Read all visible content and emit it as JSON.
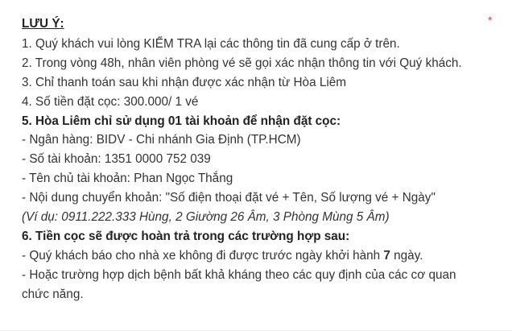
{
  "notice": {
    "heading": "LƯU Ý:",
    "required_marker": "*",
    "items": [
      "1. Quý khách vui lòng KIỂM TRA lại các thông tin đã cung cấp ở trên.",
      "2. Trong vòng 48h, nhân viên phòng vé sẽ gọi xác nhận thông tin với Quý khách.",
      "3. Chỉ thanh toán sau khi nhận được xác nhận từ Hòa Liêm",
      "4. Số tiền đặt cọc: 300.000/ 1 vé"
    ],
    "deposit_heading": "5. Hòa Liêm chỉ sử dụng 01 tài khoản để nhận đặt cọc:",
    "bank_lines": [
      "- Ngân hàng: BIDV - Chi nhánh Gia Định (TP.HCM)",
      "- Số tài khoản: 1351 0000 752 039",
      "- Tên chủ tài khoản: Phan Ngọc Thắng",
      "- Nội dung chuyển khoản: \"Số điện thoại đặt vé + Tên, Số lượng vé + Ngày\""
    ],
    "example": "(Ví dụ: 0911.222.333 Hùng, 2 Giường 26 Âm, 3 Phòng Mùng 5 Âm)",
    "refund_heading": "6. Tiền cọc sẽ được hoàn trả trong các trường hợp sau:",
    "refund_case_1": {
      "before": "- Quý khách báo cho nhà xe không đi được trước ngày khởi hành ",
      "days": "7",
      "after": " ngày."
    },
    "refund_case_2": "- Hoặc trường hợp dịch bệnh bất khả kháng theo các quy định của các cơ quan chức năng."
  }
}
